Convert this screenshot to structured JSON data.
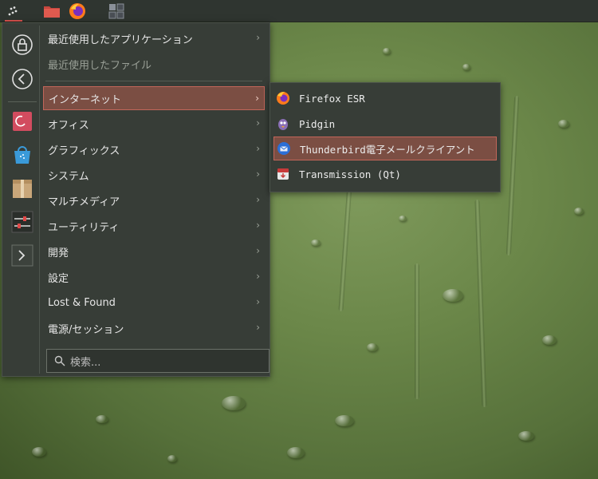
{
  "taskbar": {
    "items": [
      {
        "name": "app-launcher-icon"
      },
      {
        "name": "folder-icon"
      },
      {
        "name": "firefox-icon"
      },
      {
        "name": "desktop-switcher-icon"
      }
    ]
  },
  "sidebar": {
    "buttons": [
      {
        "name": "lock-icon"
      },
      {
        "name": "back-icon"
      },
      {
        "name": "debian-icon"
      },
      {
        "name": "software-store-icon"
      },
      {
        "name": "package-icon"
      },
      {
        "name": "settings-sliders-icon"
      },
      {
        "name": "terminal-icon"
      }
    ]
  },
  "menu": {
    "recent_apps": "最近使用したアプリケーション",
    "recent_files": "最近使用したファイル",
    "categories": [
      "インターネット",
      "オフィス",
      "グラフィックス",
      "システム",
      "マルチメディア",
      "ユーティリティ",
      "開発",
      "設定",
      "Lost & Found",
      "電源/セッション"
    ],
    "chevron": "›",
    "search_placeholder": "検索..."
  },
  "submenu": {
    "items": [
      {
        "label": "Firefox ESR",
        "icon": "firefox-icon"
      },
      {
        "label": "Pidgin",
        "icon": "pidgin-icon"
      },
      {
        "label": "Thunderbird電子メールクライアント",
        "icon": "thunderbird-icon"
      },
      {
        "label": "Transmission (Qt)",
        "icon": "transmission-icon"
      }
    ]
  }
}
